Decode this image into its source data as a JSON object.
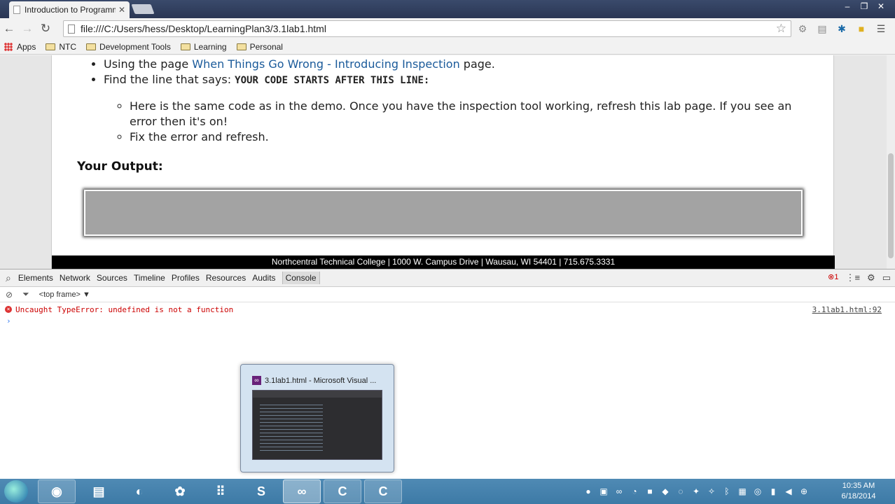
{
  "browser": {
    "tab_title": "Introduction to Programm",
    "tab_close": "✕",
    "url": "file:///C:/Users/hess/Desktop/LearningPlan3/3.1lab1.html",
    "window_controls": [
      "‒",
      "❐",
      "✕"
    ],
    "bookmarks": {
      "apps": "Apps",
      "items": [
        "NTC",
        "Development Tools",
        "Learning",
        "Personal"
      ]
    }
  },
  "page": {
    "bullet1_prefix": "Using the page ",
    "bullet1_link": "When Things Go Wrong - Introducing Inspection",
    "bullet1_suffix": " page.",
    "bullet2_prefix": "Find the line that says: ",
    "bullet2_code": "YOUR CODE STARTS AFTER THIS LINE:",
    "sub1": "Here is the same code as in the demo. Once you have the inspection tool working, refresh this lab page. If you see an error then it's on!",
    "sub2": "Fix the error and refresh.",
    "output_heading": "Your Output:",
    "footer": "Northcentral Technical College | 1000 W. Campus Drive | Wausau, WI 54401 | 715.675.3331"
  },
  "devtools": {
    "tabs": [
      "Elements",
      "Network",
      "Sources",
      "Timeline",
      "Profiles",
      "Resources",
      "Audits",
      "Console"
    ],
    "active_tab": "Console",
    "error_count": "1",
    "frame_selector": "<top frame>",
    "console_error": "Uncaught TypeError: undefined is not a function",
    "console_source": "3.1lab1.html:92",
    "prompt": "›"
  },
  "taskbar": {
    "preview_title": "3.1lab1.html - Microsoft Visual ...",
    "clock_time": "10:35 AM",
    "clock_date": "6/18/2014"
  },
  "colors": {
    "link": "#1a5a9a",
    "error": "#cc0000",
    "footer_bg": "#000000",
    "taskbar": "#3d7aa6"
  }
}
